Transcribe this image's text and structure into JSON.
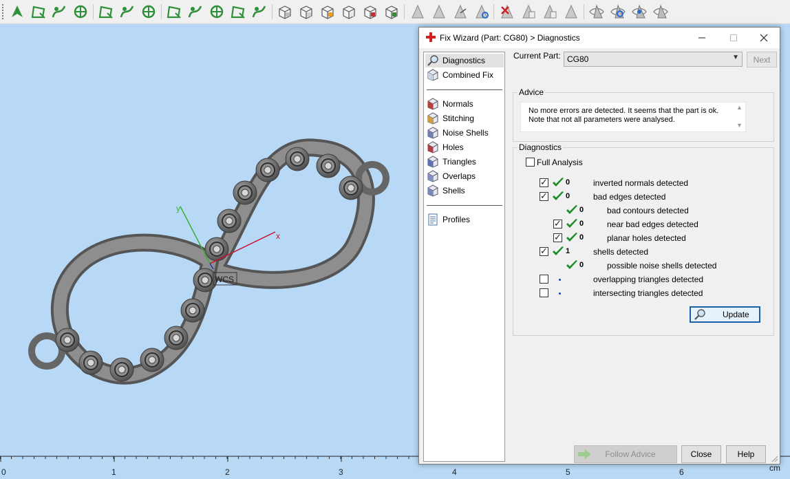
{
  "toolbar": {
    "icons": [
      "arrow-cursor-icon",
      "region-select-icon",
      "curve-select-icon",
      "wheel-select-icon",
      "rect-select-icon",
      "node-select-icon",
      "spline-select-icon",
      "mesh-select-icon",
      "flower-select-icon",
      "star-select-icon",
      "circle-grid-icon",
      "star-grid-icon",
      "cube-view-icon",
      "cube-front-icon",
      "cube-color-icon",
      "cube-wire-icon",
      "cube-shade-icon",
      "cube-green-icon",
      "triangle-grey-icon",
      "triangle-cut-icon",
      "triangle-arrow-icon",
      "triangle-refresh-icon",
      "triangle-delete-icon",
      "triangle-copy-icon",
      "triangle-page-icon",
      "triangle-flat-icon",
      "eye-triangle-icon",
      "eye-refresh-icon",
      "eye-blue-icon",
      "eye-box-icon"
    ]
  },
  "viewport": {
    "axis_x_label": "x",
    "axis_y_label": "y",
    "wcs_label": "WCS",
    "ruler_ticks": [
      "0",
      "1",
      "2",
      "3",
      "4",
      "5",
      "6"
    ],
    "ruler_unit": "cm"
  },
  "dialog": {
    "title": "Fix Wizard (Part: CG80) > Diagnostics",
    "current_part_label": "Current Part:",
    "current_part_value": "CG80",
    "next_label": "Next",
    "nav": [
      {
        "label": "Diagnostics",
        "icon": "magnifier-icon",
        "selected": true
      },
      {
        "label": "Combined Fix",
        "icon": "combined-fix-icon"
      },
      {
        "label": "Normals",
        "icon": "normals-icon"
      },
      {
        "label": "Stitching",
        "icon": "stitching-icon"
      },
      {
        "label": "Noise Shells",
        "icon": "noise-shells-icon"
      },
      {
        "label": "Holes",
        "icon": "holes-icon"
      },
      {
        "label": "Triangles",
        "icon": "triangles-icon"
      },
      {
        "label": "Overlaps",
        "icon": "overlaps-icon"
      },
      {
        "label": "Shells",
        "icon": "shells-icon"
      },
      {
        "label": "Profiles",
        "icon": "profiles-icon"
      }
    ],
    "advice_title": "Advice",
    "advice_text": "No more errors are detected. It seems that the part is ok. Note that not all parameters were analysed.",
    "diagnostics_title": "Diagnostics",
    "full_analysis_label": "Full Analysis",
    "full_analysis_checked": false,
    "rows": [
      {
        "checked": true,
        "has_checkbox": true,
        "status": "ok",
        "count": "0",
        "label": "inverted normals detected",
        "indent": 0
      },
      {
        "checked": true,
        "has_checkbox": true,
        "status": "ok",
        "count": "0",
        "label": "bad edges detected",
        "indent": 0
      },
      {
        "checked": false,
        "has_checkbox": false,
        "status": "ok",
        "count": "0",
        "label": "bad contours detected",
        "indent": 1
      },
      {
        "checked": true,
        "has_checkbox": true,
        "status": "ok",
        "count": "0",
        "label": "near bad edges detected",
        "indent": 1
      },
      {
        "checked": true,
        "has_checkbox": true,
        "status": "ok",
        "count": "0",
        "label": "planar holes detected",
        "indent": 1
      },
      {
        "checked": true,
        "has_checkbox": true,
        "status": "ok",
        "count": "1",
        "label": "shells detected",
        "indent": 0
      },
      {
        "checked": false,
        "has_checkbox": false,
        "status": "ok",
        "count": "0",
        "label": "possible noise shells detected",
        "indent": 1
      },
      {
        "checked": false,
        "has_checkbox": true,
        "status": "none",
        "count": "",
        "label": "overlapping triangles detected",
        "indent": 0
      },
      {
        "checked": false,
        "has_checkbox": true,
        "status": "none",
        "count": "",
        "label": "intersecting triangles detected",
        "indent": 0
      }
    ],
    "update_label": "Update",
    "follow_advice_label": "Follow Advice",
    "close_label": "Close",
    "help_label": "Help"
  },
  "colors": {
    "viewport_bg": "#b8d9f6",
    "model_grey": "#6f6f6f",
    "check_green": "#1f8a2a",
    "axis_x": "#c8102e",
    "axis_y": "#38b038",
    "accent_blue": "#1c5fa8"
  }
}
